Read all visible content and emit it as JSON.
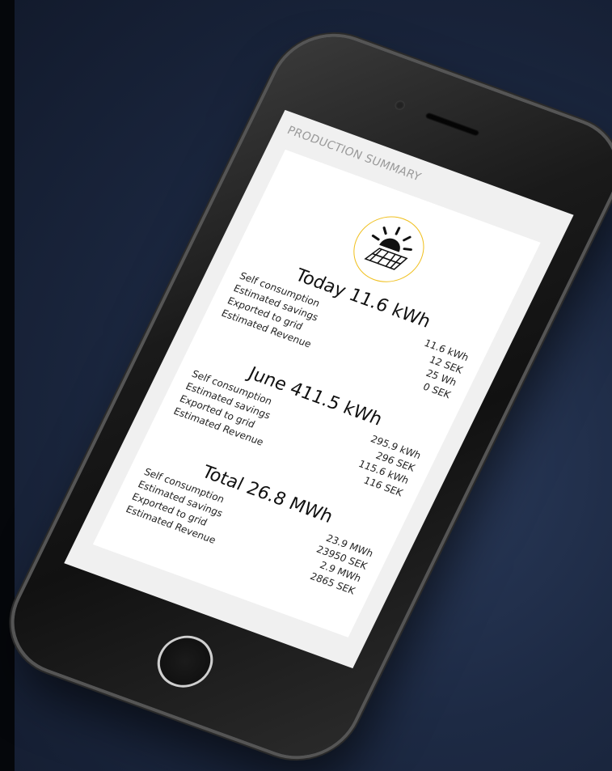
{
  "screen": {
    "title": "PRODUCTION SUMMARY"
  },
  "sections": [
    {
      "title": "Today 11.6 kWh",
      "rows": [
        {
          "label": "Self consumption",
          "value": "11.6 kWh"
        },
        {
          "label": "Estimated savings",
          "value": "12 SEK"
        },
        {
          "label": "Exported to grid",
          "value": "25 Wh"
        },
        {
          "label": "Estimated Revenue",
          "value": "0 SEK"
        }
      ]
    },
    {
      "title": "June 411.5 kWh",
      "rows": [
        {
          "label": "Self consumption",
          "value": "295.9 kWh"
        },
        {
          "label": "Estimated savings",
          "value": "296 SEK"
        },
        {
          "label": "Exported to grid",
          "value": "115.6 kWh"
        },
        {
          "label": "Estimated Revenue",
          "value": "116 SEK"
        }
      ]
    },
    {
      "title": "Total 26.8 MWh",
      "rows": [
        {
          "label": "Self consumption",
          "value": "23.9 MWh"
        },
        {
          "label": "Estimated savings",
          "value": "23950 SEK"
        },
        {
          "label": "Exported to grid",
          "value": "2.9 MWh"
        },
        {
          "label": "Estimated Revenue",
          "value": "2865 SEK"
        }
      ]
    }
  ],
  "icons": {
    "badge": "sun-solar-panel-icon"
  },
  "colors": {
    "accent": "#f0c020",
    "background": "#1d2a44",
    "screen": "#f0f0f0",
    "card": "#ffffff"
  }
}
